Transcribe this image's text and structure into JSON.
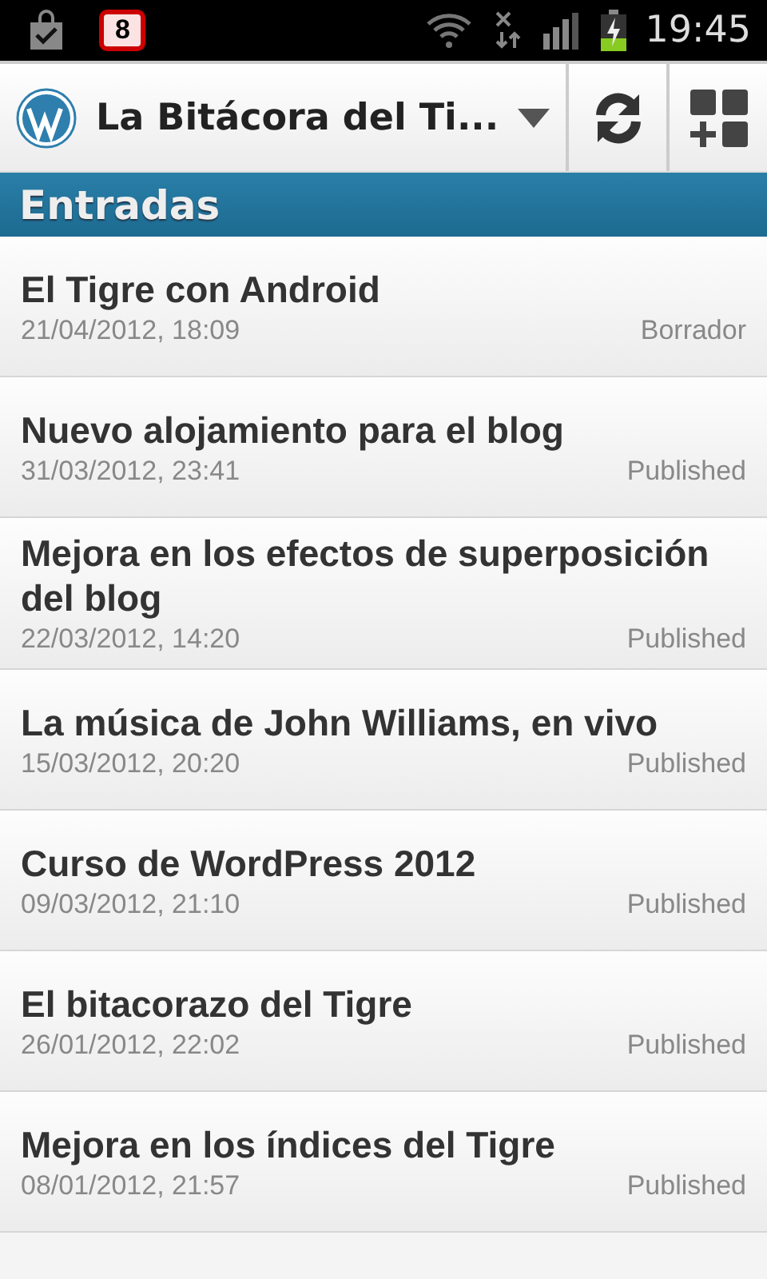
{
  "status_bar": {
    "notification_count": "8",
    "time": "19:45"
  },
  "action_bar": {
    "blog_title": "La Bitácora del Ti..."
  },
  "section": {
    "title": "Entradas"
  },
  "posts": [
    {
      "title": "El Tigre con Android",
      "date": "21/04/2012, 18:09",
      "status": "Borrador"
    },
    {
      "title": "Nuevo alojamiento para el blog",
      "date": "31/03/2012, 23:41",
      "status": "Published"
    },
    {
      "title": "Mejora en los efectos de superposición del blog",
      "date": "22/03/2012, 14:20",
      "status": "Published"
    },
    {
      "title": "La música de John Williams, en vivo",
      "date": "15/03/2012, 20:20",
      "status": "Published"
    },
    {
      "title": "Curso de WordPress 2012",
      "date": "09/03/2012, 21:10",
      "status": "Published"
    },
    {
      "title": "El bitacorazo del Tigre",
      "date": "26/01/2012, 22:02",
      "status": "Published"
    },
    {
      "title": "Mejora en los índices del Tigre",
      "date": "08/01/2012, 21:57",
      "status": "Published"
    }
  ]
}
